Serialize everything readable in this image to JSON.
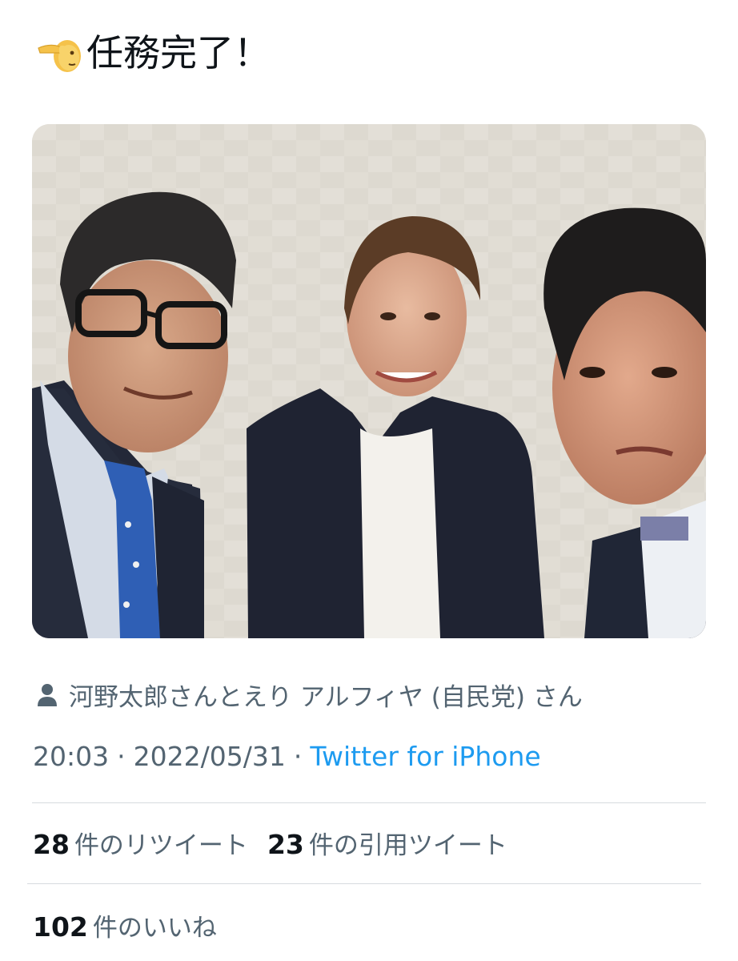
{
  "tweet": {
    "emoji_icon": "backhand-index-pointing-left-emoji",
    "text": "任務完了！"
  },
  "photo": {
    "description_icon": "photo-image"
  },
  "tagged": {
    "icon": "person-icon",
    "text": "河野太郎さんとえり アルフィヤ (自民党) さん"
  },
  "meta": {
    "time": "20:03",
    "separator": "·",
    "date": "2022/05/31",
    "source": "Twitter for iPhone",
    "source_color": "#1d9bf0"
  },
  "stats": {
    "retweets_count": "28",
    "retweets_label": "件のリツイート",
    "quotes_count": "23",
    "quotes_label": "件の引用ツイート",
    "likes_count": "102",
    "likes_label": "件のいいね"
  }
}
